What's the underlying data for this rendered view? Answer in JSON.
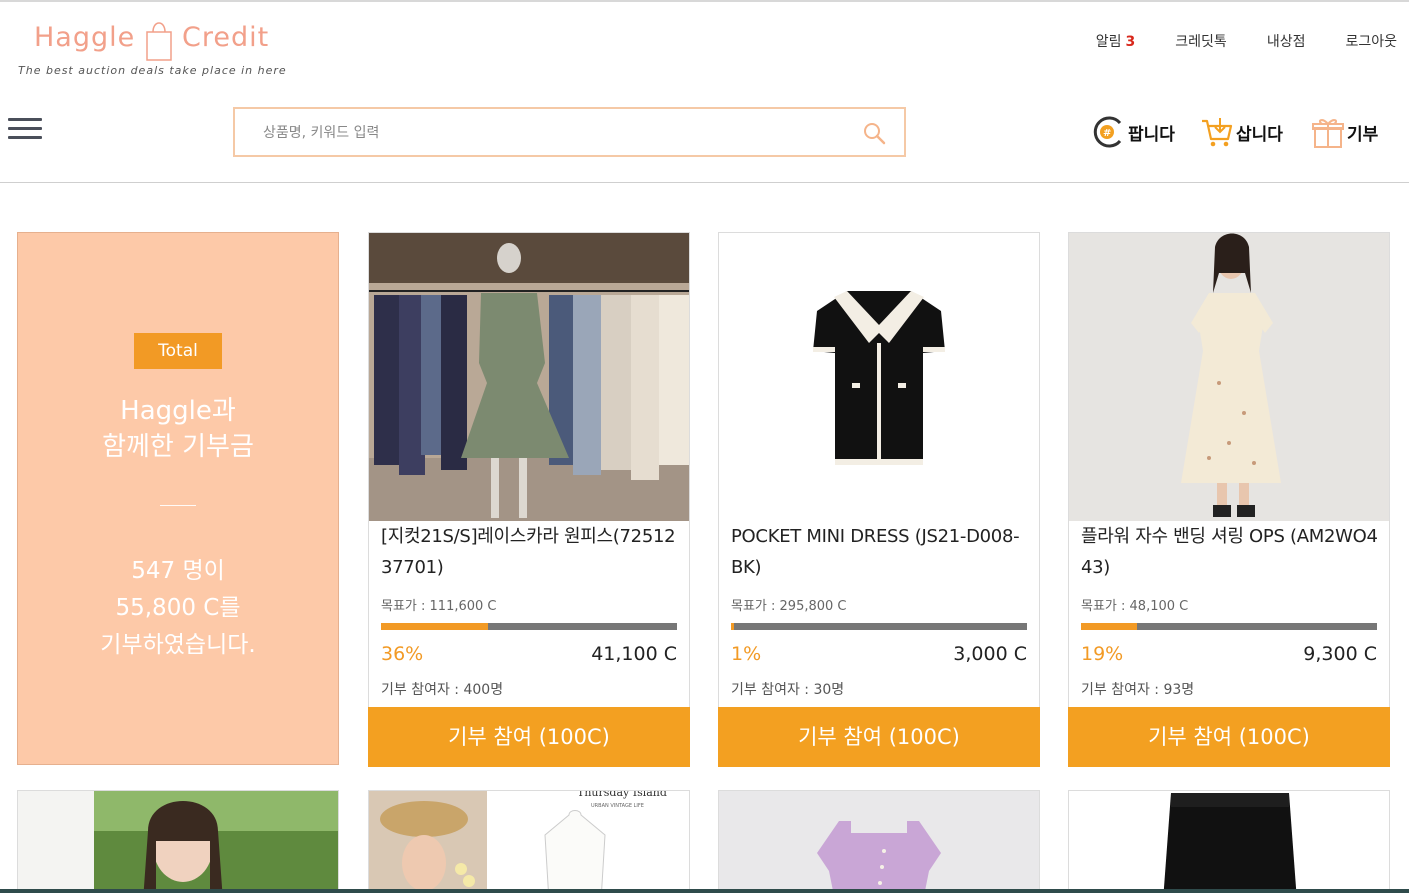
{
  "header": {
    "logo_word1": "Haggle",
    "logo_word2": "Credit",
    "logo_tagline": "The best auction deals take place in here",
    "top_links": {
      "alarm": "알림",
      "alarm_count": "3",
      "credit_talk": "크레딧톡",
      "my_store": "내상점",
      "logout": "로그아웃"
    },
    "search_placeholder": "상품명, 키워드 입력",
    "actions": {
      "sell": "팝니다",
      "buy": "삽니다",
      "donate": "기부"
    }
  },
  "total": {
    "badge": "Total",
    "title": "Haggle과\n함께한 기부금",
    "line1": "547 명이",
    "line2": "55,800 C를",
    "line3": "기부하였습니다."
  },
  "products": [
    {
      "name": "[지컷21S/S]레이스카라 원피스(7251237701)",
      "goal": "목표가 : 111,600 C",
      "percent": "36%",
      "progress": 0.36,
      "amount": "41,100 C",
      "participants": "기부 참여자 : 400명",
      "button": "기부 참여 (100C)"
    },
    {
      "name": "POCKET MINI DRESS (JS21-D008-BK)",
      "goal": "목표가 : 295,800 C",
      "percent": "1%",
      "progress": 0.01,
      "amount": "3,000 C",
      "participants": "기부 참여자 : 30명",
      "button": "기부 참여 (100C)"
    },
    {
      "name": "플라워 자수 밴딩 셔링 OPS (AM2WO443)",
      "goal": "목표가 : 48,100 C",
      "percent": "19%",
      "progress": 0.19,
      "amount": "9,300 C",
      "participants": "기부 참여자 : 93명",
      "button": "기부 참여 (100C)"
    }
  ],
  "second_row": {
    "card2_caption": "Thursday Island",
    "card2_sub": "URBAN VINTAGE LIFE"
  },
  "colors": {
    "accent": "#f3a021",
    "total_bg": "#fdc9a8",
    "logo": "#f2a08a",
    "search_border": "#f5c9a6"
  }
}
